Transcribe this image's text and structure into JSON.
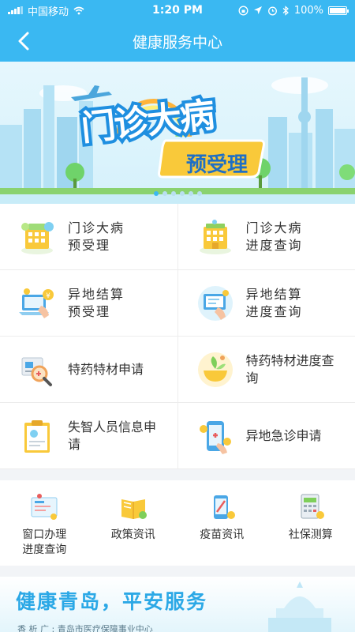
{
  "status_bar": {
    "carrier": "中国移动",
    "time": "1:20 PM",
    "battery": "100%"
  },
  "header": {
    "title": "健康服务中心"
  },
  "banner": {
    "line1": "门诊大病",
    "line2": "预受理",
    "page_count": 6,
    "active_index": 0
  },
  "grid": [
    {
      "label": "门诊大病\n预受理",
      "icon": "building-form-icon"
    },
    {
      "label": "门诊大病\n进度查询",
      "icon": "building-search-icon"
    },
    {
      "label": "异地结算\n预受理",
      "icon": "laptop-coin-icon"
    },
    {
      "label": "异地结算\n进度查询",
      "icon": "laptop-check-icon"
    },
    {
      "label": "特药特材申请",
      "icon": "document-magnifier-icon"
    },
    {
      "label": "特药特材进度查\n询",
      "icon": "herb-bowl-icon"
    },
    {
      "label": "失智人员信息申\n请",
      "icon": "clipboard-profile-icon"
    },
    {
      "label": "异地急诊申请",
      "icon": "phone-medical-icon"
    }
  ],
  "quick_links": [
    {
      "label": "窗口办理\n进度查询",
      "icon": "window-progress-icon"
    },
    {
      "label": "政策资讯",
      "icon": "policy-book-icon"
    },
    {
      "label": "疫苗资讯",
      "icon": "vaccine-phone-icon"
    },
    {
      "label": "社保测算",
      "icon": "calculator-icon"
    }
  ],
  "promo": {
    "title": "健康青岛，平安服务",
    "subtitle": "香 析 广 : 青岛市医疗保障事业中心"
  },
  "colors": {
    "primary": "#3ab8f2",
    "banner_text": "#1f8fe0",
    "accent_yellow": "#f9c93a"
  }
}
